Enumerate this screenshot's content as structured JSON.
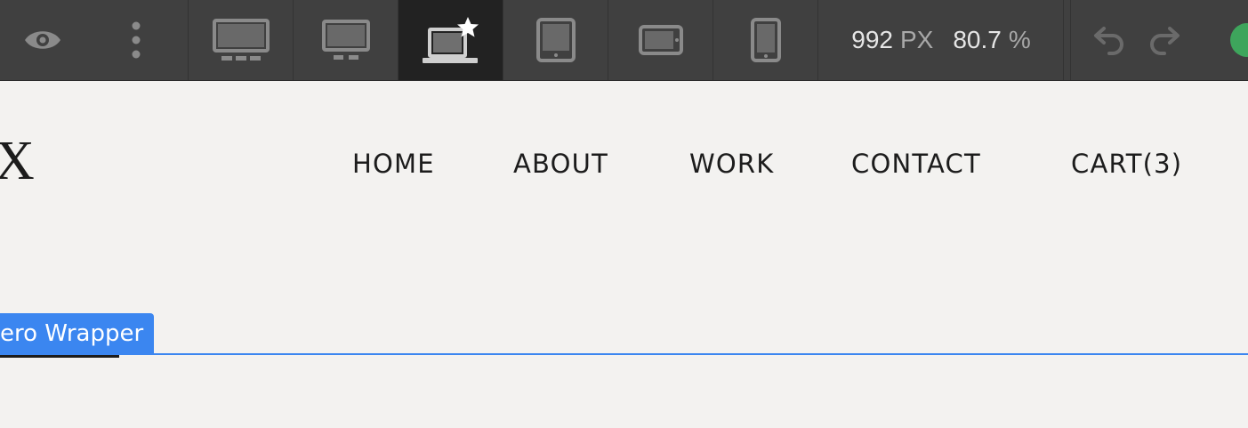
{
  "toolbar": {
    "preview_icon": "eye-icon",
    "more_icon": "vertical-dots-icon",
    "breakpoints": [
      {
        "name": "desktop-xl",
        "icon": "monitor-large-icon",
        "active": false
      },
      {
        "name": "desktop-large",
        "icon": "monitor-icon",
        "active": false
      },
      {
        "name": "desktop",
        "icon": "laptop-star-icon",
        "active": true
      },
      {
        "name": "tablet",
        "icon": "tablet-icon",
        "active": false
      },
      {
        "name": "mobile-landscape",
        "icon": "phone-landscape-icon",
        "active": false
      },
      {
        "name": "mobile-portrait",
        "icon": "phone-portrait-icon",
        "active": false
      }
    ],
    "width_value": "992",
    "width_unit": "PX",
    "zoom_value": "80.7",
    "zoom_unit": "%",
    "undo_icon": "undo-icon",
    "redo_icon": "redo-icon",
    "publish_color": "#3ea55c"
  },
  "page": {
    "logo": "X",
    "nav": [
      "HOME",
      "ABOUT",
      "WORK",
      "CONTACT",
      "CART(3)"
    ]
  },
  "selection": {
    "label": "ero Wrapper",
    "color": "#3b86f0"
  }
}
